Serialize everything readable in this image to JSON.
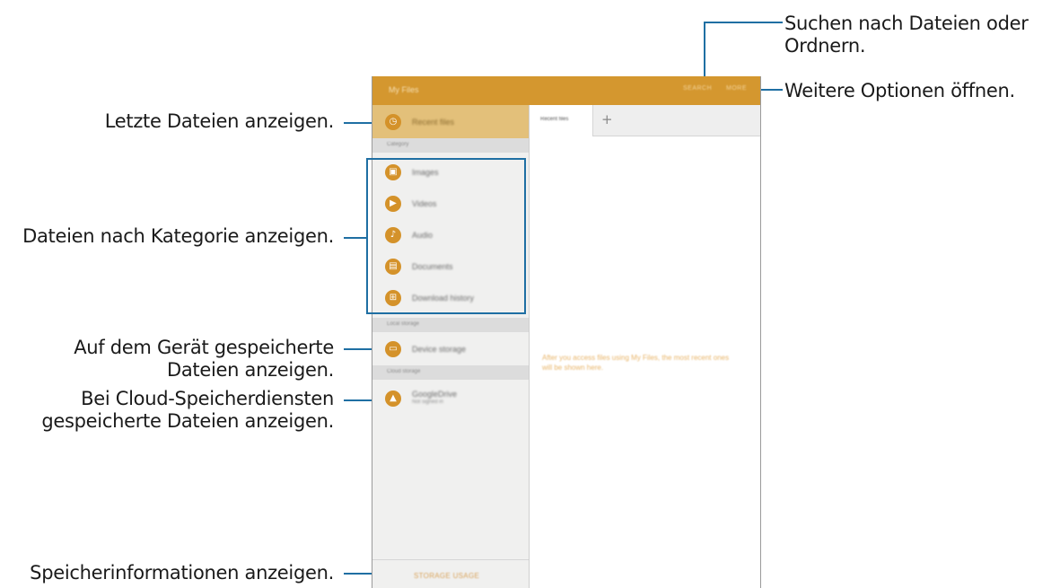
{
  "callouts": {
    "search": "Suchen nach Dateien oder Ordnern.",
    "search_line1": "Suchen nach Dateien oder",
    "search_line2": "Ordnern.",
    "more": "Weitere Optionen öffnen.",
    "recent": "Letzte Dateien anzeigen.",
    "category": "Dateien nach Kategorie anzeigen.",
    "device_line1": "Auf dem Gerät gespeicherte",
    "device_line2": "Dateien anzeigen.",
    "cloud_line1": "Bei Cloud-Speicherdiensten",
    "cloud_line2": "gespeicherte Dateien anzeigen.",
    "storage": "Speicherinformationen anzeigen."
  },
  "app": {
    "title": "My Files",
    "search_label": "SEARCH",
    "more_label": "MORE"
  },
  "sidebar": {
    "recent": "Recent files",
    "category_header": "Category",
    "categories": [
      {
        "label": "Images",
        "icon": "image-icon"
      },
      {
        "label": "Videos",
        "icon": "video-icon"
      },
      {
        "label": "Audio",
        "icon": "audio-icon"
      },
      {
        "label": "Documents",
        "icon": "document-icon"
      },
      {
        "label": "Download history",
        "icon": "download-icon"
      }
    ],
    "local_header": "Local storage",
    "device_storage": "Device storage",
    "cloud_header": "Cloud storage",
    "cloud_name": "GoogleDrive",
    "cloud_status": "Not signed in",
    "storage_usage": "STORAGE USAGE"
  },
  "content": {
    "tab": "Recent files",
    "add_tab": "+",
    "empty_message": "After you access files using My Files, the most recent ones will be shown here."
  },
  "colors": {
    "appbar": "#d4972f",
    "accent": "#d4922a",
    "callout_line": "#1f6fa3"
  }
}
